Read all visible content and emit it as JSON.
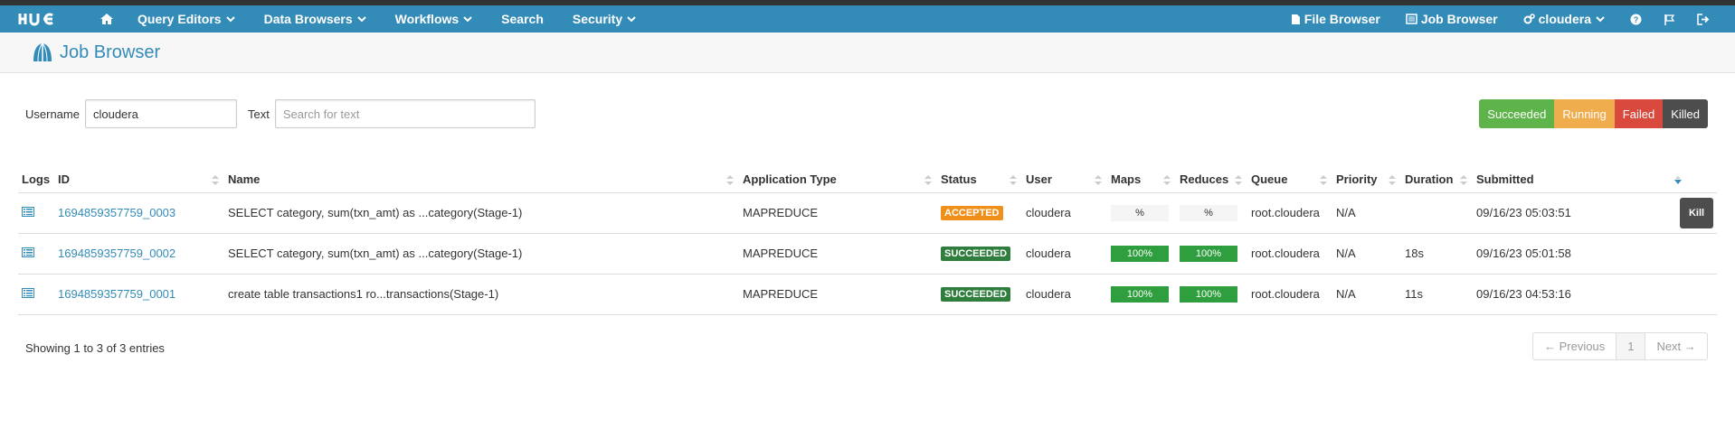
{
  "nav": {
    "logo": "HUE",
    "home_icon": "home-icon",
    "menus": [
      {
        "label": "Query Editors",
        "dropdown": true
      },
      {
        "label": "Data Browsers",
        "dropdown": true
      },
      {
        "label": "Workflows",
        "dropdown": true
      },
      {
        "label": "Search",
        "dropdown": false
      },
      {
        "label": "Security",
        "dropdown": true
      }
    ],
    "right": {
      "file_browser": "File Browser",
      "job_browser": "Job Browser",
      "user": "cloudera"
    },
    "colors": {
      "bar": "#338bb8",
      "strip": "#333333"
    }
  },
  "header": {
    "title": "Job Browser",
    "icon": "job-browser-icon"
  },
  "filters": {
    "username_label": "Username",
    "username_value": "cloudera",
    "text_label": "Text",
    "text_placeholder": "Search for text",
    "status_buttons": [
      "Succeeded",
      "Running",
      "Failed",
      "Killed"
    ]
  },
  "table": {
    "headers": {
      "logs": "Logs",
      "id": "ID",
      "name": "Name",
      "app_type": "Application Type",
      "status": "Status",
      "user": "User",
      "maps": "Maps",
      "reduces": "Reduces",
      "queue": "Queue",
      "priority": "Priority",
      "duration": "Duration",
      "submitted": "Submitted"
    },
    "rows": [
      {
        "id": "1694859357759_0003",
        "name": "SELECT category, sum(txn_amt) as ...category(Stage-1)",
        "app_type": "MAPREDUCE",
        "status": "ACCEPTED",
        "user": "cloudera",
        "maps": "%",
        "reduces": "%",
        "queue": "root.cloudera",
        "priority": "N/A",
        "duration": "",
        "submitted": "09/16/23 05:03:51",
        "kill_label": "Kill"
      },
      {
        "id": "1694859357759_0002",
        "name": "SELECT category, sum(txn_amt) as ...category(Stage-1)",
        "app_type": "MAPREDUCE",
        "status": "SUCCEEDED",
        "user": "cloudera",
        "maps": "100%",
        "reduces": "100%",
        "queue": "root.cloudera",
        "priority": "N/A",
        "duration": "18s",
        "submitted": "09/16/23 05:01:58"
      },
      {
        "id": "1694859357759_0001",
        "name": "create table transactions1 ro...transactions(Stage-1)",
        "app_type": "MAPREDUCE",
        "status": "SUCCEEDED",
        "user": "cloudera",
        "maps": "100%",
        "reduces": "100%",
        "queue": "root.cloudera",
        "priority": "N/A",
        "duration": "11s",
        "submitted": "09/16/23 04:53:16"
      }
    ]
  },
  "footer": {
    "info": "Showing 1 to 3 of 3 entries",
    "prev": "← Previous",
    "page": "1",
    "next": "Next →"
  }
}
